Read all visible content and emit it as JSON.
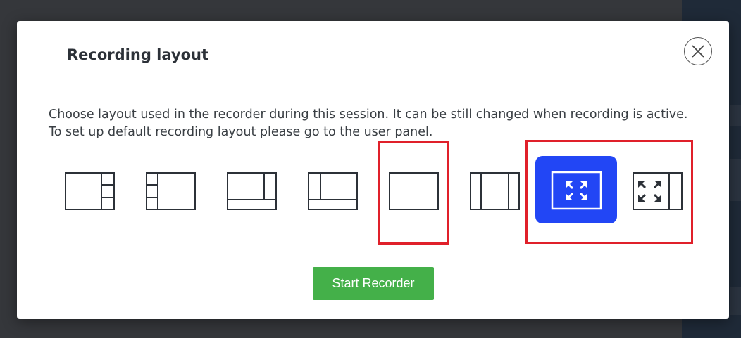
{
  "dialog": {
    "title": "Recording layout",
    "close_icon": "close-circle-icon",
    "description": "Choose layout used in the recorder during this session. It can be still changed when recording is active. To set up default recording layout please go to the user panel.",
    "start_button_label": "Start Recorder"
  },
  "layouts": [
    {
      "name": "layout-main-right-sidebar",
      "icon": "layout-main-right-sidebar-icon",
      "selected": false
    },
    {
      "name": "layout-left-sidebar-main",
      "icon": "layout-left-sidebar-main-icon",
      "selected": false
    },
    {
      "name": "layout-main-bottom-strip-right",
      "icon": "layout-main-bottom-strip-right-icon",
      "selected": false
    },
    {
      "name": "layout-left-main-bottom-strip",
      "icon": "layout-left-main-bottom-strip-icon",
      "selected": false
    },
    {
      "name": "layout-single-frame",
      "icon": "layout-single-frame-icon",
      "selected": false
    },
    {
      "name": "layout-both-sidebars",
      "icon": "layout-both-sidebars-icon",
      "selected": false
    },
    {
      "name": "layout-fullscreen",
      "icon": "fullscreen-arrows-icon",
      "selected": true
    },
    {
      "name": "layout-fullscreen-right-sidebar",
      "icon": "fullscreen-arrows-sidebar-icon",
      "selected": false
    }
  ],
  "colors": {
    "selected_bg": "#2246f5",
    "highlight": "#e0202a",
    "start_button": "#44b049",
    "icon_stroke": "#2c3138"
  }
}
